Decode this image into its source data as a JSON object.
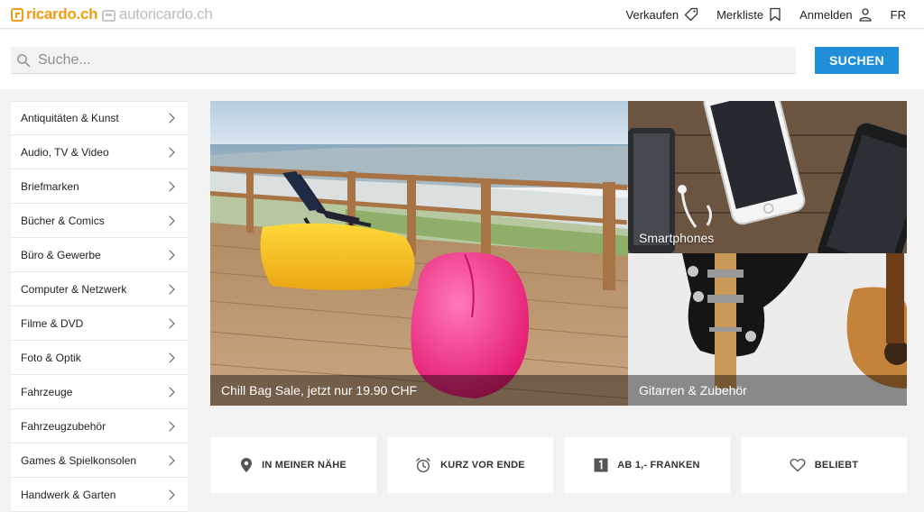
{
  "header": {
    "logo_ricardo": "ricardo.ch",
    "logo_auto": "autoricardo.ch",
    "nav": {
      "sell": "Verkaufen",
      "watchlist": "Merkliste",
      "login": "Anmelden",
      "language": "FR"
    }
  },
  "search": {
    "placeholder": "Suche...",
    "button": "SUCHEN"
  },
  "categories": [
    "Antiquitäten & Kunst",
    "Audio, TV & Video",
    "Briefmarken",
    "Bücher & Comics",
    "Büro & Gewerbe",
    "Computer & Netzwerk",
    "Filme & DVD",
    "Foto & Optik",
    "Fahrzeuge",
    "Fahrzeugzubehör",
    "Games & Spielkonsolen",
    "Handwerk & Garten"
  ],
  "hero": {
    "main_caption": "Chill Bag Sale, jetzt nur 19.90 CHF",
    "side1_caption": "Smartphones",
    "side2_caption": "Gitarren & Zubehör"
  },
  "quicklinks": {
    "nearby": "IN MEINER NÄHE",
    "ending": "KURZ VOR ENDE",
    "from1": "AB 1,- FRANKEN",
    "popular": "BELIEBT"
  },
  "colors": {
    "brand": "#f39c12",
    "search_button": "#1e8fd8"
  }
}
